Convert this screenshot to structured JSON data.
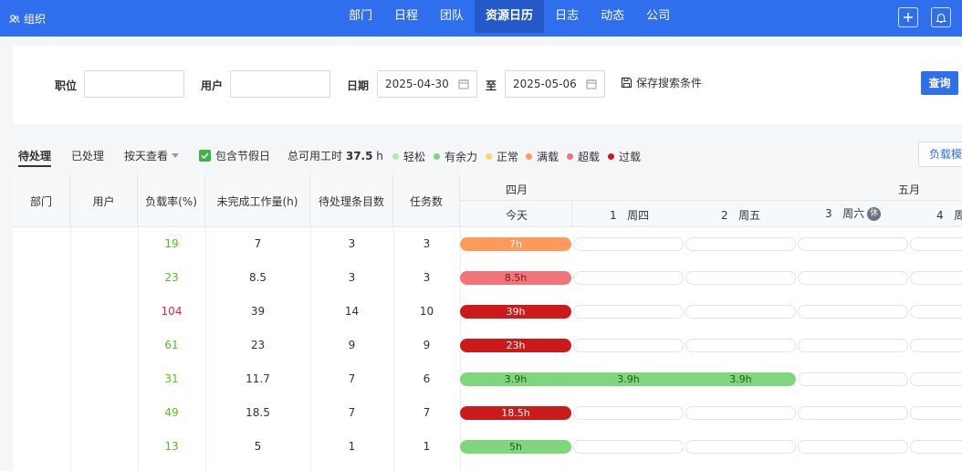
{
  "topbar": {
    "org_label": "组织",
    "nav": [
      {
        "label": "部门",
        "active": false
      },
      {
        "label": "日程",
        "active": false
      },
      {
        "label": "团队",
        "active": false
      },
      {
        "label": "资源日历",
        "active": true
      },
      {
        "label": "日志",
        "active": false
      },
      {
        "label": "动态",
        "active": false
      },
      {
        "label": "公司",
        "active": false
      }
    ],
    "accent": "#2f6fed"
  },
  "filters": {
    "position_label": "职位",
    "user_label": "用户",
    "date_label": "日期",
    "date_from": "2025-04-30",
    "to_label": "至",
    "date_to": "2025-05-06",
    "save_label": "保存搜索条件",
    "query_label": "查询"
  },
  "tabs": {
    "pending": "待处理",
    "done": "已处理",
    "view_by": "按天查看",
    "include_holiday": "包含节假日",
    "total_hours_label": "总可用工时",
    "total_hours_value": "37.5",
    "total_hours_unit": "h",
    "load_model_btn": "负载模"
  },
  "legend": [
    {
      "label": "轻松",
      "color": "#b7e8b5"
    },
    {
      "label": "有余力",
      "color": "#7fd67c"
    },
    {
      "label": "正常",
      "color": "#ffd27a"
    },
    {
      "label": "满载",
      "color": "#ff9a5c"
    },
    {
      "label": "超载",
      "color": "#f2747a"
    },
    {
      "label": "过载",
      "color": "#cc1a1a"
    }
  ],
  "table": {
    "headers": {
      "dept": "部门",
      "user": "用户",
      "load_rate": "负载率(%)",
      "unfinished": "未完成工作量(h)",
      "pending_items": "待处理条目数",
      "tasks": "任务数"
    },
    "months": {
      "april": "四月",
      "may": "五月"
    },
    "days": {
      "today": "今天",
      "d1_num": "1",
      "d1_wd": "周四",
      "d2_num": "2",
      "d2_wd": "周五",
      "d3_num": "3",
      "d3_wd": "周六",
      "d3_badge": "休",
      "d4_num": "4",
      "d4_wd": "周"
    },
    "rows": [
      {
        "load": "19",
        "unfinished": "7",
        "pending": "3",
        "tasks": "3",
        "bars": [
          "7h"
        ]
      },
      {
        "load": "23",
        "unfinished": "8.5",
        "pending": "3",
        "tasks": "3",
        "bars": [
          "8.5h"
        ]
      },
      {
        "load": "104",
        "unfinished": "39",
        "pending": "14",
        "tasks": "10",
        "bars": [
          "39h"
        ]
      },
      {
        "load": "61",
        "unfinished": "23",
        "pending": "9",
        "tasks": "9",
        "bars": [
          "23h"
        ]
      },
      {
        "load": "31",
        "unfinished": "11.7",
        "pending": "7",
        "tasks": "6",
        "bars": [
          "3.9h",
          "3.9h",
          "3.9h"
        ]
      },
      {
        "load": "49",
        "unfinished": "18.5",
        "pending": "7",
        "tasks": "7",
        "bars": [
          "18.5h"
        ]
      },
      {
        "load": "13",
        "unfinished": "5",
        "pending": "1",
        "tasks": "1",
        "bars": [
          "5h"
        ]
      }
    ],
    "colors": {
      "load_ok": "#52c41a",
      "load_over": "#f5222d"
    }
  }
}
